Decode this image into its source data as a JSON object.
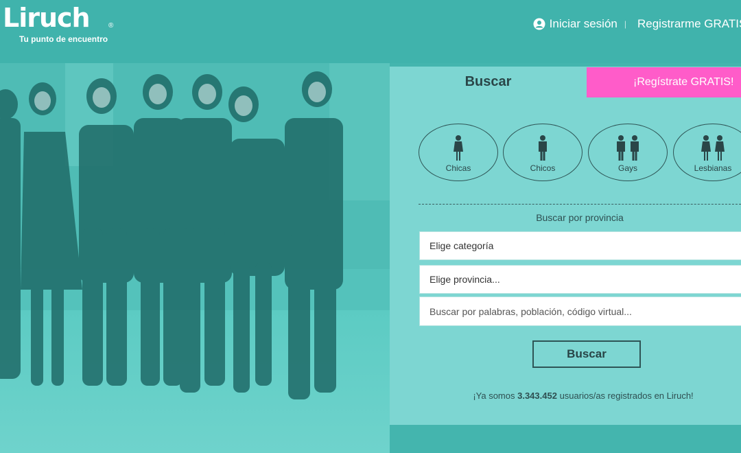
{
  "header": {
    "logo": {
      "word": "Liruch",
      "registered": "®",
      "tagline": "Tu punto de encuentro"
    },
    "nav": {
      "login_icon": "user-circle-icon",
      "login": "Iniciar sesión",
      "separator": "|",
      "register": "Registrarme GRATIS"
    }
  },
  "hero": {
    "image": "group-of-friends-thumbs-up-photo"
  },
  "search_panel": {
    "tabs": {
      "search": "Buscar",
      "register": "¡Regístrate GRATIS!"
    },
    "categories": [
      {
        "label": "Chicas",
        "icon": "woman-icon"
      },
      {
        "label": "Chicos",
        "icon": "man-icon"
      },
      {
        "label": "Gays",
        "icon": "two-men-icon"
      },
      {
        "label": "Lesbianas",
        "icon": "two-women-icon"
      }
    ],
    "province_label": "Buscar por provincia",
    "category_select": "Elige categoría",
    "province_select": "Elige provincia...",
    "keyword_placeholder": "Buscar por palabras, población, código virtual...",
    "search_button": "Buscar",
    "stats": {
      "prefix": "¡Ya somos ",
      "count": "3.343.452",
      "suffix": " usuarios/as registrados en Liruch!"
    }
  },
  "colors": {
    "background": "#44b5ae",
    "panel": "#7dd6d2",
    "register_tab": "#ff5cc9",
    "text_dark": "#2a4648"
  }
}
